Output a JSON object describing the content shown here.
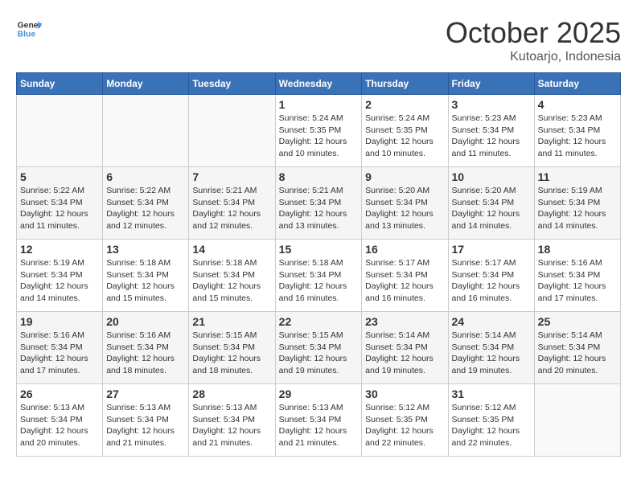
{
  "header": {
    "logo_line1": "General",
    "logo_line2": "Blue",
    "month": "October 2025",
    "location": "Kutoarjo, Indonesia"
  },
  "weekdays": [
    "Sunday",
    "Monday",
    "Tuesday",
    "Wednesday",
    "Thursday",
    "Friday",
    "Saturday"
  ],
  "weeks": [
    [
      {
        "day": "",
        "info": ""
      },
      {
        "day": "",
        "info": ""
      },
      {
        "day": "",
        "info": ""
      },
      {
        "day": "1",
        "info": "Sunrise: 5:24 AM\nSunset: 5:35 PM\nDaylight: 12 hours\nand 10 minutes."
      },
      {
        "day": "2",
        "info": "Sunrise: 5:24 AM\nSunset: 5:35 PM\nDaylight: 12 hours\nand 10 minutes."
      },
      {
        "day": "3",
        "info": "Sunrise: 5:23 AM\nSunset: 5:34 PM\nDaylight: 12 hours\nand 11 minutes."
      },
      {
        "day": "4",
        "info": "Sunrise: 5:23 AM\nSunset: 5:34 PM\nDaylight: 12 hours\nand 11 minutes."
      }
    ],
    [
      {
        "day": "5",
        "info": "Sunrise: 5:22 AM\nSunset: 5:34 PM\nDaylight: 12 hours\nand 11 minutes."
      },
      {
        "day": "6",
        "info": "Sunrise: 5:22 AM\nSunset: 5:34 PM\nDaylight: 12 hours\nand 12 minutes."
      },
      {
        "day": "7",
        "info": "Sunrise: 5:21 AM\nSunset: 5:34 PM\nDaylight: 12 hours\nand 12 minutes."
      },
      {
        "day": "8",
        "info": "Sunrise: 5:21 AM\nSunset: 5:34 PM\nDaylight: 12 hours\nand 13 minutes."
      },
      {
        "day": "9",
        "info": "Sunrise: 5:20 AM\nSunset: 5:34 PM\nDaylight: 12 hours\nand 13 minutes."
      },
      {
        "day": "10",
        "info": "Sunrise: 5:20 AM\nSunset: 5:34 PM\nDaylight: 12 hours\nand 14 minutes."
      },
      {
        "day": "11",
        "info": "Sunrise: 5:19 AM\nSunset: 5:34 PM\nDaylight: 12 hours\nand 14 minutes."
      }
    ],
    [
      {
        "day": "12",
        "info": "Sunrise: 5:19 AM\nSunset: 5:34 PM\nDaylight: 12 hours\nand 14 minutes."
      },
      {
        "day": "13",
        "info": "Sunrise: 5:18 AM\nSunset: 5:34 PM\nDaylight: 12 hours\nand 15 minutes."
      },
      {
        "day": "14",
        "info": "Sunrise: 5:18 AM\nSunset: 5:34 PM\nDaylight: 12 hours\nand 15 minutes."
      },
      {
        "day": "15",
        "info": "Sunrise: 5:18 AM\nSunset: 5:34 PM\nDaylight: 12 hours\nand 16 minutes."
      },
      {
        "day": "16",
        "info": "Sunrise: 5:17 AM\nSunset: 5:34 PM\nDaylight: 12 hours\nand 16 minutes."
      },
      {
        "day": "17",
        "info": "Sunrise: 5:17 AM\nSunset: 5:34 PM\nDaylight: 12 hours\nand 16 minutes."
      },
      {
        "day": "18",
        "info": "Sunrise: 5:16 AM\nSunset: 5:34 PM\nDaylight: 12 hours\nand 17 minutes."
      }
    ],
    [
      {
        "day": "19",
        "info": "Sunrise: 5:16 AM\nSunset: 5:34 PM\nDaylight: 12 hours\nand 17 minutes."
      },
      {
        "day": "20",
        "info": "Sunrise: 5:16 AM\nSunset: 5:34 PM\nDaylight: 12 hours\nand 18 minutes."
      },
      {
        "day": "21",
        "info": "Sunrise: 5:15 AM\nSunset: 5:34 PM\nDaylight: 12 hours\nand 18 minutes."
      },
      {
        "day": "22",
        "info": "Sunrise: 5:15 AM\nSunset: 5:34 PM\nDaylight: 12 hours\nand 19 minutes."
      },
      {
        "day": "23",
        "info": "Sunrise: 5:14 AM\nSunset: 5:34 PM\nDaylight: 12 hours\nand 19 minutes."
      },
      {
        "day": "24",
        "info": "Sunrise: 5:14 AM\nSunset: 5:34 PM\nDaylight: 12 hours\nand 19 minutes."
      },
      {
        "day": "25",
        "info": "Sunrise: 5:14 AM\nSunset: 5:34 PM\nDaylight: 12 hours\nand 20 minutes."
      }
    ],
    [
      {
        "day": "26",
        "info": "Sunrise: 5:13 AM\nSunset: 5:34 PM\nDaylight: 12 hours\nand 20 minutes."
      },
      {
        "day": "27",
        "info": "Sunrise: 5:13 AM\nSunset: 5:34 PM\nDaylight: 12 hours\nand 21 minutes."
      },
      {
        "day": "28",
        "info": "Sunrise: 5:13 AM\nSunset: 5:34 PM\nDaylight: 12 hours\nand 21 minutes."
      },
      {
        "day": "29",
        "info": "Sunrise: 5:13 AM\nSunset: 5:34 PM\nDaylight: 12 hours\nand 21 minutes."
      },
      {
        "day": "30",
        "info": "Sunrise: 5:12 AM\nSunset: 5:35 PM\nDaylight: 12 hours\nand 22 minutes."
      },
      {
        "day": "31",
        "info": "Sunrise: 5:12 AM\nSunset: 5:35 PM\nDaylight: 12 hours\nand 22 minutes."
      },
      {
        "day": "",
        "info": ""
      }
    ]
  ]
}
